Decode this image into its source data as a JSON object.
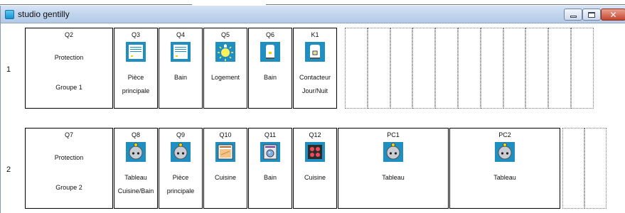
{
  "window": {
    "title": "studio gentilly",
    "controls": [
      "minimize",
      "maximize",
      "close"
    ]
  },
  "colors": {
    "icon_blue": "#1f8fc2",
    "titlebar": "#c6d8ee",
    "close_red": "#c84a32"
  },
  "rows": [
    {
      "number": "1",
      "main": {
        "code": "Q2",
        "label1": "Protection",
        "label2": "Groupe 1"
      },
      "modules": [
        {
          "code": "Q3",
          "icon": "window-icon",
          "line1": "Pièce",
          "line2": "principale"
        },
        {
          "code": "Q4",
          "icon": "window-icon",
          "line1": "Bain",
          "line2": ""
        },
        {
          "code": "Q5",
          "icon": "lightbulb-icon",
          "line1": "Logement",
          "line2": ""
        },
        {
          "code": "Q6",
          "icon": "water-heater-icon",
          "line1": "Bain",
          "line2": ""
        },
        {
          "code": "K1",
          "icon": "water-heater-contactor-icon",
          "line1": "Contacteur",
          "line2": "Jour/Nuit"
        }
      ],
      "empty_slots": 11
    },
    {
      "number": "2",
      "main": {
        "code": "Q7",
        "label1": "Protection",
        "label2": "Groupe 2"
      },
      "modules": [
        {
          "code": "Q8",
          "icon": "socket-icon",
          "line1": "Tableau",
          "line2": "Cuisine/Bain"
        },
        {
          "code": "Q9",
          "icon": "socket-icon",
          "line1": "Pièce",
          "line2": "principale"
        },
        {
          "code": "Q10",
          "icon": "oven-icon",
          "line1": "Cuisine",
          "line2": ""
        },
        {
          "code": "Q11",
          "icon": "washing-machine-icon",
          "line1": "Bain",
          "line2": ""
        },
        {
          "code": "Q12",
          "icon": "cooktop-icon",
          "line1": "Cuisine",
          "line2": ""
        },
        {
          "code": "PC1",
          "icon": "socket-icon",
          "line1": "Tableau",
          "line2": ""
        },
        {
          "code": "PC2",
          "icon": "socket-icon",
          "line1": "Tableau",
          "line2": ""
        }
      ],
      "empty_slots": 2
    }
  ]
}
